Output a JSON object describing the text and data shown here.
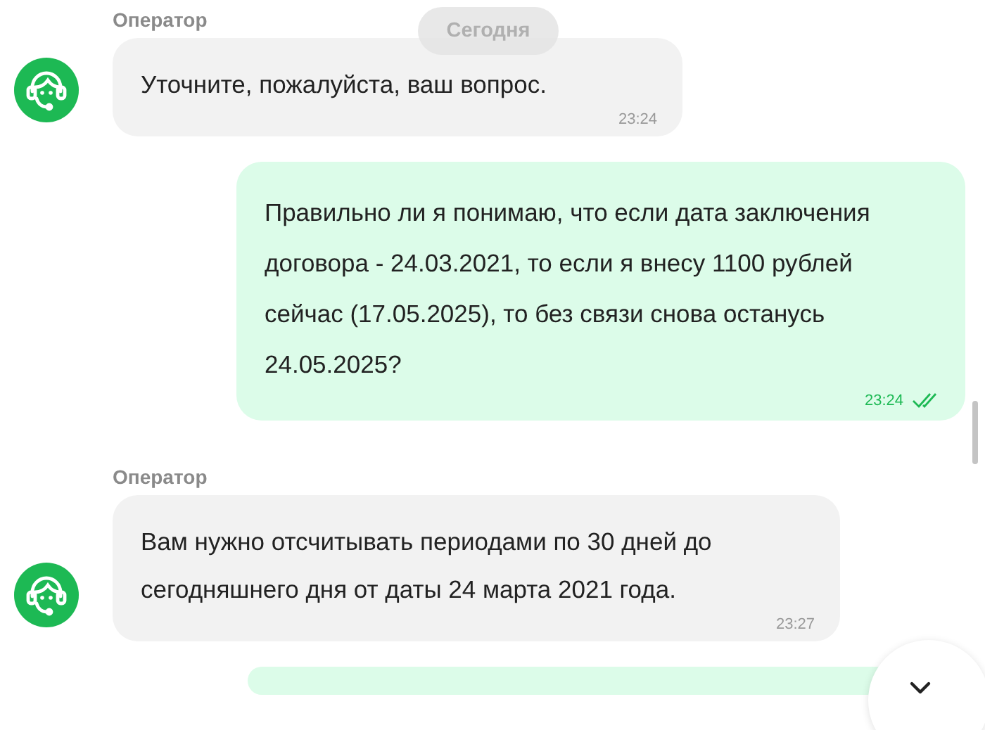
{
  "date_chip": "Сегодня",
  "messages": [
    {
      "kind": "operator",
      "author": "Оператор",
      "text": "Уточните, пожалуйста, ваш вопрос.",
      "time": "23:24"
    },
    {
      "kind": "user",
      "text": "Правильно ли я понимаю, что если дата заключения договора - 24.03.2021, то если я внесу 1100 рублей сейчас (17.05.2025), то без связи снова останусь 24.05.2025?",
      "time": "23:24",
      "read": true
    },
    {
      "kind": "operator",
      "author": "Оператор",
      "text": "Вам нужно отсчитывать периодами по 30 дней до сегодняшнего дня от даты 24 марта 2021 года.",
      "time": "23:27"
    },
    {
      "kind": "user"
    }
  ]
}
